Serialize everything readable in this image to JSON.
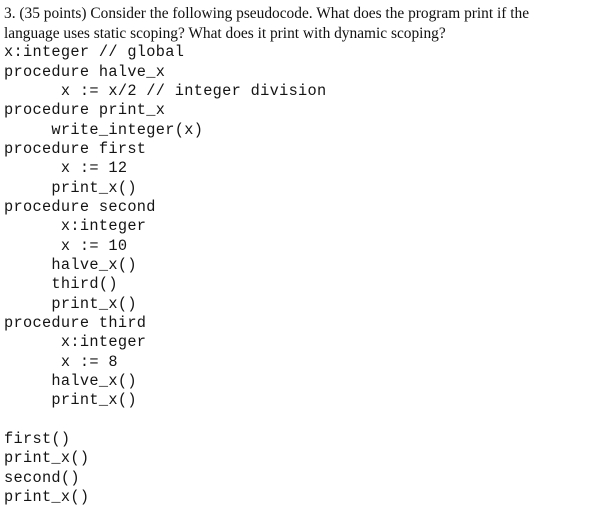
{
  "document": {
    "background_color": "#ffffff",
    "text_color": "#141414"
  },
  "question": {
    "number": "3.",
    "points": "(35 points)",
    "prompt": "3. (35 points) Consider the following pseudocode. What does the program print if the language uses static scoping? What does it print with dynamic scoping?"
  },
  "code": {
    "lines": [
      "x:integer // global",
      "procedure halve_x",
      "      x := x/2 // integer division",
      "procedure print_x",
      "     write_integer(x)",
      "procedure first",
      "      x := 12",
      "     print_x()",
      "procedure second",
      "      x:integer",
      "      x := 10",
      "     halve_x()",
      "     third()",
      "     print_x()",
      "procedure third",
      "      x:integer",
      "      x := 8",
      "     halve_x()",
      "     print_x()",
      "",
      "first()",
      "print_x()",
      "second()",
      "print_x()"
    ]
  }
}
